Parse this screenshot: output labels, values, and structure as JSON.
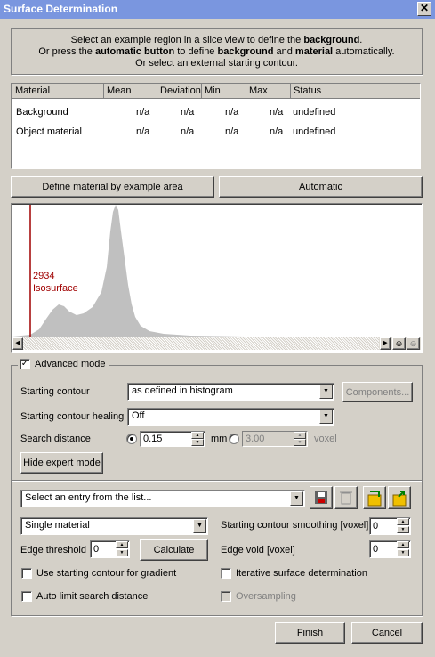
{
  "window": {
    "title": "Surface Determination",
    "close_glyph": "✕"
  },
  "instructions": {
    "line1_pre": "Select an example region in a slice view to define the ",
    "line1_bold": "background",
    "line1_post": ".",
    "line2_a": "Or press the ",
    "line2_b": "automatic button",
    "line2_c": " to define ",
    "line2_d": "background",
    "line2_e": " and ",
    "line2_f": "material",
    "line2_g": " automatically.",
    "line3": "Or select an external starting contour."
  },
  "table": {
    "columns": [
      "Material",
      "Mean",
      "Deviation",
      "Min",
      "Max",
      "Status"
    ],
    "rows": [
      {
        "material": "Background",
        "mean": "n/a",
        "deviation": "n/a",
        "min": "n/a",
        "max": "n/a",
        "status": "undefined"
      },
      {
        "material": "Object material",
        "mean": "n/a",
        "deviation": "n/a",
        "min": "n/a",
        "max": "n/a",
        "status": "undefined"
      }
    ]
  },
  "buttons": {
    "define_example": "Define material by example area",
    "automatic": "Automatic"
  },
  "histogram": {
    "iso_value": "2934",
    "iso_label": "Isosurface",
    "iso_color": "#a00000",
    "fill_color": "#c0c0c0"
  },
  "advanced": {
    "label": "Advanced mode",
    "checked": true,
    "starting_contour_label": "Starting contour",
    "starting_contour_value": "as defined in histogram",
    "components_button": "Components...",
    "healing_label": "Starting contour healing",
    "healing_value": "Off",
    "search_distance_label": "Search distance",
    "search_mm_value": "0.15",
    "unit_mm": "mm",
    "search_voxel_value": "3.00",
    "unit_voxel": "voxel",
    "hide_expert_button": "Hide expert mode"
  },
  "expert": {
    "preset_placeholder": "Select an entry from the list...",
    "material_mode": "Single material",
    "smoothing_label": "Starting contour smoothing [voxel]",
    "smoothing_value": "0",
    "edge_threshold_label": "Edge threshold",
    "edge_threshold_value": "0",
    "calculate_button": "Calculate",
    "edge_void_label": "Edge void [voxel]",
    "edge_void_value": "0",
    "use_contour_gradient": "Use starting contour for gradient",
    "iterative": "Iterative surface determination",
    "auto_limit": "Auto limit search distance",
    "oversampling": "Oversampling"
  },
  "footer": {
    "finish": "Finish",
    "cancel": "Cancel"
  }
}
